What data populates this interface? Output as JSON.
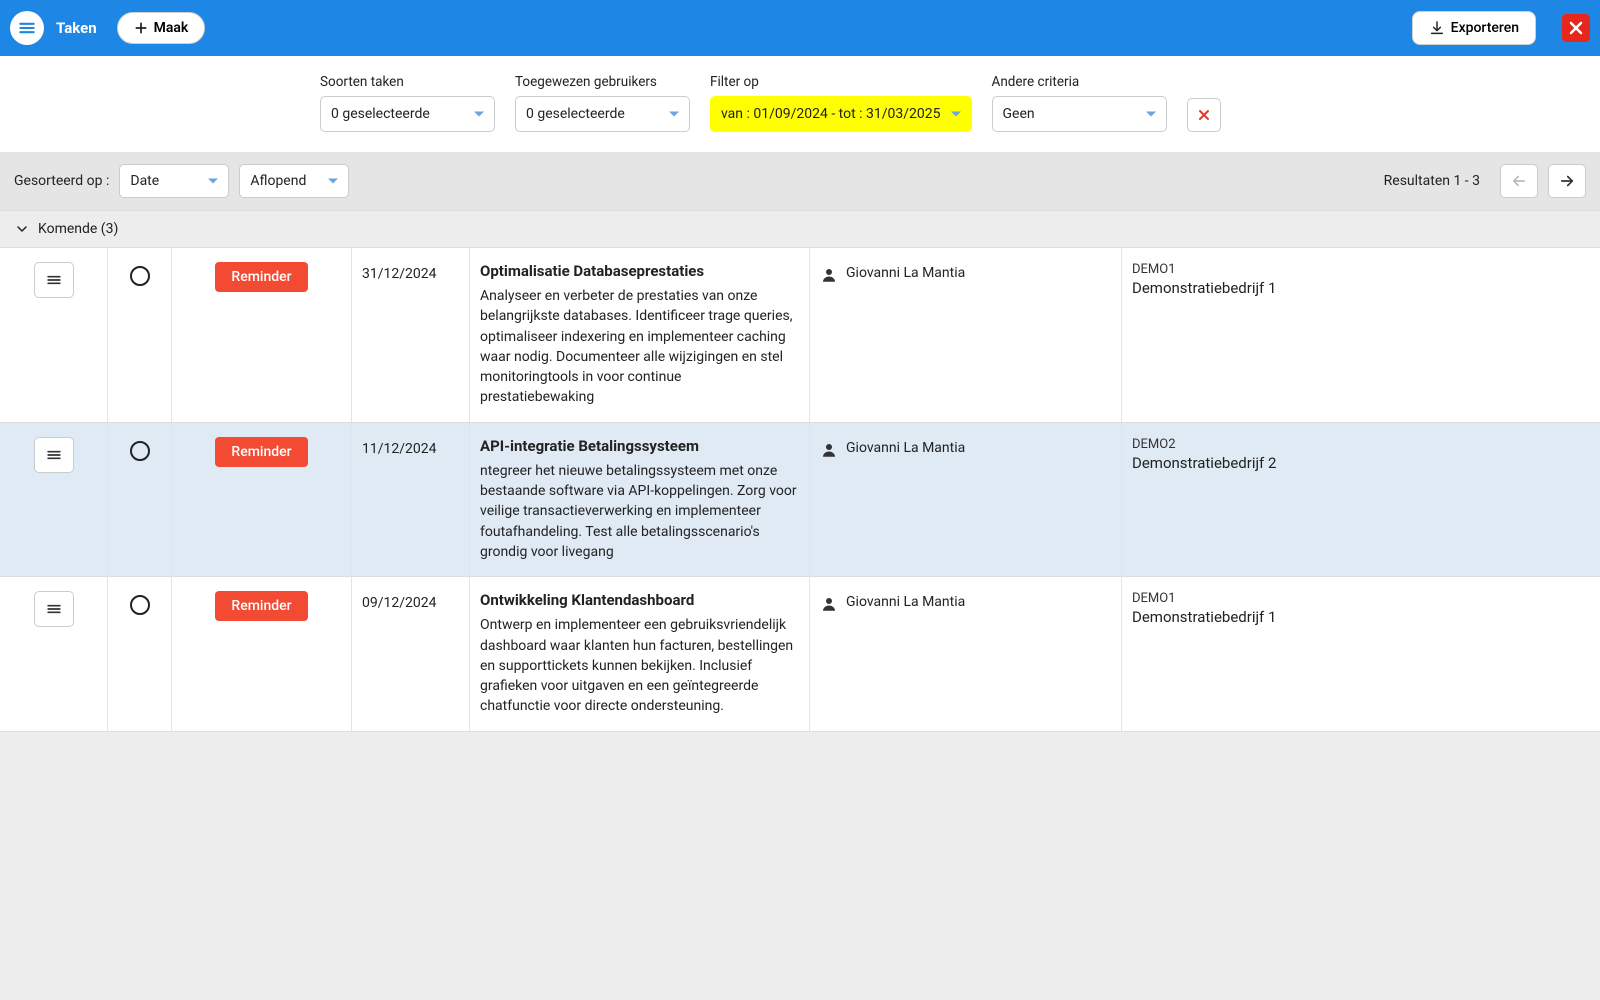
{
  "header": {
    "title": "Taken",
    "create_label": "Maak",
    "export_label": "Exporteren"
  },
  "filters": {
    "types": {
      "label": "Soorten taken",
      "value": "0 geselecteerde"
    },
    "users": {
      "label": "Toegewezen gebruikers",
      "value": "0 geselecteerde"
    },
    "filter_on": {
      "label": "Filter op",
      "value": "van : 01/09/2024 - tot : 31/03/2025"
    },
    "other": {
      "label": "Andere criteria",
      "value": "Geen"
    }
  },
  "sort": {
    "label": "Gesorteerd op :",
    "field": "Date",
    "direction": "Aflopend",
    "results_text": "Resultaten 1 - 3"
  },
  "section": {
    "title": "Komende (3)"
  },
  "rows": [
    {
      "tag": "Reminder",
      "date": "31/12/2024",
      "title": "Optimalisatie Databaseprestaties",
      "desc": "Analyseer en verbeter de prestaties van onze belangrijkste databases. Identificeer trage queries, optimaliseer indexering en implementeer caching waar nodig. Documenteer alle wijzigingen en stel monitoringtools in voor continue prestatiebewaking",
      "user": "Giovanni La Mantia",
      "company_code": "DEMO1",
      "company_name": "Demonstratiebedrijf 1"
    },
    {
      "tag": "Reminder",
      "date": "11/12/2024",
      "title": "API-integratie Betalingssysteem",
      "desc": "ntegreer het nieuwe betalingssysteem met onze bestaande software via API-koppelingen. Zorg voor veilige transactieverwerking en implementeer foutafhandeling. Test alle betalingsscenario's grondig voor livegang",
      "user": "Giovanni La Mantia",
      "company_code": "DEMO2",
      "company_name": "Demonstratiebedrijf 2"
    },
    {
      "tag": "Reminder",
      "date": "09/12/2024",
      "title": "Ontwikkeling Klantendashboard",
      "desc": "Ontwerp en implementeer een gebruiksvriendelijk dashboard waar klanten hun facturen, bestellingen en supporttickets kunnen bekijken. Inclusief grafieken voor uitgaven en een geïntegreerde chatfunctie voor directe ondersteuning.",
      "user": "Giovanni La Mantia",
      "company_code": "DEMO1",
      "company_name": "Demonstratiebedrijf 1"
    }
  ]
}
